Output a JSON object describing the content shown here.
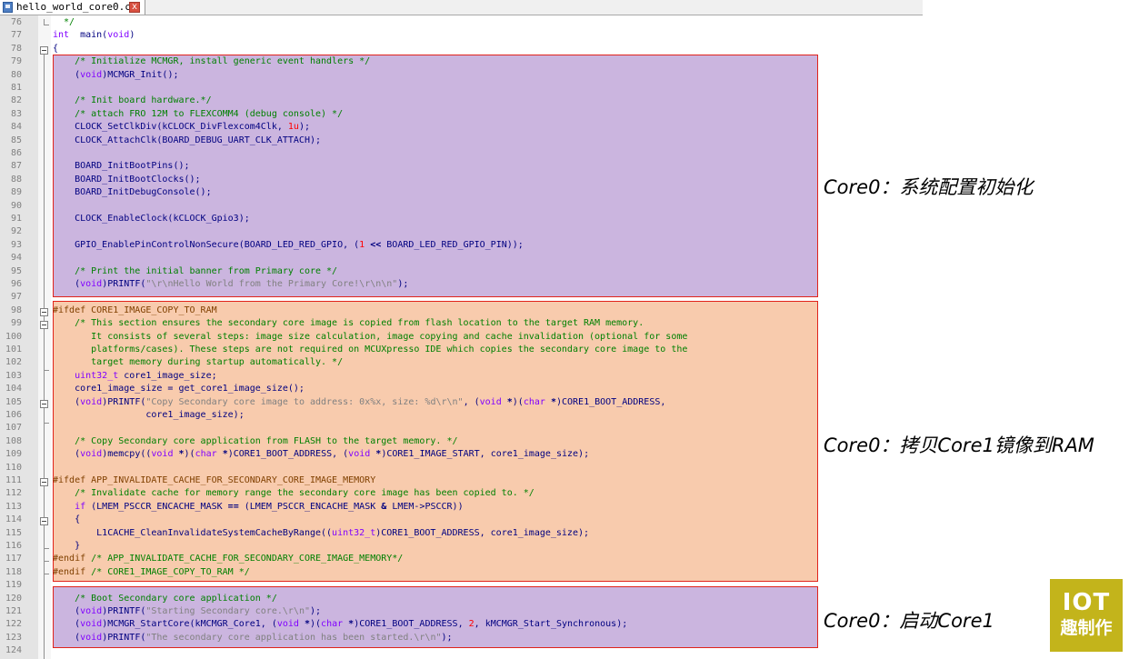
{
  "tab": {
    "filename": "hello_world_core0.c"
  },
  "lines": [
    {
      "n": "76",
      "seg": [
        [
          "c-com",
          "  */"
        ]
      ]
    },
    {
      "n": "77",
      "seg": [
        [
          "c-kw",
          "int"
        ],
        [
          "",
          "  main("
        ],
        [
          "c-kw",
          "void"
        ],
        [
          "",
          ")"
        ]
      ]
    },
    {
      "n": "78",
      "seg": [
        [
          "",
          "{"
        ]
      ]
    },
    {
      "n": "79",
      "seg": [
        [
          "c-com",
          "    /* Initialize MCMGR, install generic event handlers */"
        ]
      ]
    },
    {
      "n": "80",
      "seg": [
        [
          "",
          "    ("
        ],
        [
          "c-kw",
          "void"
        ],
        [
          "",
          ")MCMGR_Init();"
        ]
      ]
    },
    {
      "n": "81",
      "seg": []
    },
    {
      "n": "82",
      "seg": [
        [
          "c-com",
          "    /* Init board hardware.*/"
        ]
      ]
    },
    {
      "n": "83",
      "seg": [
        [
          "c-com",
          "    /* attach FRO 12M to FLEXCOMM4 (debug console) */"
        ]
      ]
    },
    {
      "n": "84",
      "seg": [
        [
          "",
          "    CLOCK_SetClkDiv(kCLOCK_DivFlexcom4Clk, "
        ],
        [
          "c-num",
          "1u"
        ],
        [
          "",
          ");"
        ]
      ]
    },
    {
      "n": "85",
      "seg": [
        [
          "",
          "    CLOCK_AttachClk(BOARD_DEBUG_UART_CLK_ATTACH);"
        ]
      ]
    },
    {
      "n": "86",
      "seg": []
    },
    {
      "n": "87",
      "seg": [
        [
          "",
          "    BOARD_InitBootPins();"
        ]
      ]
    },
    {
      "n": "88",
      "seg": [
        [
          "",
          "    BOARD_InitBootClocks();"
        ]
      ]
    },
    {
      "n": "89",
      "seg": [
        [
          "",
          "    BOARD_InitDebugConsole();"
        ]
      ]
    },
    {
      "n": "90",
      "seg": []
    },
    {
      "n": "91",
      "seg": [
        [
          "",
          "    CLOCK_EnableClock(kCLOCK_Gpio3);"
        ]
      ]
    },
    {
      "n": "92",
      "seg": []
    },
    {
      "n": "93",
      "seg": [
        [
          "",
          "    GPIO_EnablePinControlNonSecure(BOARD_LED_RED_GPIO, ("
        ],
        [
          "c-num",
          "1"
        ],
        [
          "c-op",
          " << "
        ],
        [
          "",
          "BOARD_LED_RED_GPIO_PIN));"
        ]
      ]
    },
    {
      "n": "94",
      "seg": []
    },
    {
      "n": "95",
      "seg": [
        [
          "c-com",
          "    /* Print the initial banner from Primary core */"
        ]
      ]
    },
    {
      "n": "96",
      "seg": [
        [
          "",
          "    ("
        ],
        [
          "c-kw",
          "void"
        ],
        [
          "",
          ")PRINTF("
        ],
        [
          "c-str",
          "\"\\r\\nHello World from the Primary Core!\\r\\n\\n\""
        ],
        [
          "",
          ");"
        ]
      ]
    },
    {
      "n": "97",
      "seg": []
    },
    {
      "n": "98",
      "seg": [
        [
          "c-pp",
          "#ifdef CORE1_IMAGE_COPY_TO_RAM"
        ]
      ]
    },
    {
      "n": "99",
      "seg": [
        [
          "c-com",
          "    /* This section ensures the secondary core image is copied from flash location to the target RAM memory."
        ]
      ]
    },
    {
      "n": "100",
      "seg": [
        [
          "c-com",
          "       It consists of several steps: image size calculation, image copying and cache invalidation (optional for some"
        ]
      ]
    },
    {
      "n": "101",
      "seg": [
        [
          "c-com",
          "       platforms/cases). These steps are not required on MCUXpresso IDE which copies the secondary core image to the"
        ]
      ]
    },
    {
      "n": "102",
      "seg": [
        [
          "c-com",
          "       target memory during startup automatically. */"
        ]
      ]
    },
    {
      "n": "103",
      "seg": [
        [
          "c-kw",
          "    uint32_t"
        ],
        [
          "",
          " core1_image_size;"
        ]
      ]
    },
    {
      "n": "104",
      "seg": [
        [
          "",
          "    core1_image_size = get_core1_image_size();"
        ]
      ]
    },
    {
      "n": "105",
      "seg": [
        [
          "",
          "    ("
        ],
        [
          "c-kw",
          "void"
        ],
        [
          "",
          ")PRINTF("
        ],
        [
          "c-str",
          "\"Copy Secondary core image to address: 0x%x, size: %d\\r\\n\""
        ],
        [
          "",
          ", ("
        ],
        [
          "c-kw",
          "void"
        ],
        [
          "c-op",
          " *"
        ],
        [
          "",
          ")("
        ],
        [
          "c-kw",
          "char"
        ],
        [
          "c-op",
          " *"
        ],
        [
          "",
          ")CORE1_BOOT_ADDRESS,"
        ]
      ]
    },
    {
      "n": "106",
      "seg": [
        [
          "",
          "                 core1_image_size);"
        ]
      ]
    },
    {
      "n": "107",
      "seg": []
    },
    {
      "n": "108",
      "seg": [
        [
          "c-com",
          "    /* Copy Secondary core application from FLASH to the target memory. */"
        ]
      ]
    },
    {
      "n": "109",
      "seg": [
        [
          "",
          "    ("
        ],
        [
          "c-kw",
          "void"
        ],
        [
          "",
          ")memcpy(("
        ],
        [
          "c-kw",
          "void"
        ],
        [
          "c-op",
          " *"
        ],
        [
          "",
          ")("
        ],
        [
          "c-kw",
          "char"
        ],
        [
          "c-op",
          " *"
        ],
        [
          "",
          ")CORE1_BOOT_ADDRESS, ("
        ],
        [
          "c-kw",
          "void"
        ],
        [
          "c-op",
          " *"
        ],
        [
          "",
          ")CORE1_IMAGE_START, core1_image_size);"
        ]
      ]
    },
    {
      "n": "110",
      "seg": []
    },
    {
      "n": "111",
      "seg": [
        [
          "c-pp",
          "#ifdef APP_INVALIDATE_CACHE_FOR_SECONDARY_CORE_IMAGE_MEMORY"
        ]
      ]
    },
    {
      "n": "112",
      "seg": [
        [
          "c-com",
          "    /* Invalidate cache for memory range the secondary core image has been copied to. */"
        ]
      ]
    },
    {
      "n": "113",
      "seg": [
        [
          "c-kw",
          "    if"
        ],
        [
          "",
          " (LMEM_PSCCR_ENCACHE_MASK "
        ],
        [
          "c-op",
          "=="
        ],
        [
          "",
          " (LMEM_PSCCR_ENCACHE_MASK "
        ],
        [
          "c-op",
          "&"
        ],
        [
          "",
          " LMEM->PSCCR))"
        ]
      ]
    },
    {
      "n": "114",
      "seg": [
        [
          "",
          "    {"
        ]
      ]
    },
    {
      "n": "115",
      "seg": [
        [
          "",
          "        L1CACHE_CleanInvalidateSystemCacheByRange(("
        ],
        [
          "c-kw",
          "uint32_t"
        ],
        [
          "",
          ")CORE1_BOOT_ADDRESS, core1_image_size);"
        ]
      ]
    },
    {
      "n": "116",
      "seg": [
        [
          "",
          "    }"
        ]
      ]
    },
    {
      "n": "117",
      "seg": [
        [
          "c-pp",
          "#endif"
        ],
        [
          "c-com",
          " /* APP_INVALIDATE_CACHE_FOR_SECONDARY_CORE_IMAGE_MEMORY*/"
        ]
      ]
    },
    {
      "n": "118",
      "seg": [
        [
          "c-pp",
          "#endif"
        ],
        [
          "c-com",
          " /* CORE1_IMAGE_COPY_TO_RAM */"
        ]
      ]
    },
    {
      "n": "119",
      "seg": []
    },
    {
      "n": "120",
      "seg": [
        [
          "c-com",
          "    /* Boot Secondary core application */"
        ]
      ]
    },
    {
      "n": "121",
      "seg": [
        [
          "",
          "    ("
        ],
        [
          "c-kw",
          "void"
        ],
        [
          "",
          ")PRINTF("
        ],
        [
          "c-str",
          "\"Starting Secondary core.\\r\\n\""
        ],
        [
          "",
          ");"
        ]
      ]
    },
    {
      "n": "122",
      "seg": [
        [
          "",
          "    ("
        ],
        [
          "c-kw",
          "void"
        ],
        [
          "",
          ")MCMGR_StartCore(kMCMGR_Core1, ("
        ],
        [
          "c-kw",
          "void"
        ],
        [
          "c-op",
          " *"
        ],
        [
          "",
          ")("
        ],
        [
          "c-kw",
          "char"
        ],
        [
          "c-op",
          " *"
        ],
        [
          "",
          ")CORE1_BOOT_ADDRESS, "
        ],
        [
          "c-num",
          "2"
        ],
        [
          "",
          ", kMCMGR_Start_Synchronous);"
        ]
      ]
    },
    {
      "n": "123",
      "seg": [
        [
          "",
          "    ("
        ],
        [
          "c-kw",
          "void"
        ],
        [
          "",
          ")PRINTF("
        ],
        [
          "c-str",
          "\"The secondary core application has been started.\\r\\n\""
        ],
        [
          "",
          ");"
        ]
      ]
    },
    {
      "n": "124",
      "seg": []
    }
  ],
  "annotations": {
    "core0_init": "Core0：系统配置初始化",
    "core0_copy": "Core0：拷贝Core1镜像到RAM",
    "core0_boot": "Core0：启动Core1"
  },
  "logo": {
    "line1": "IOT",
    "line2": "趣制作"
  },
  "colors": {
    "purple_block": "#cbb5df",
    "orange_block": "#f8cbad",
    "border": "#e0231b",
    "logo_bg": "#c3b41b"
  }
}
